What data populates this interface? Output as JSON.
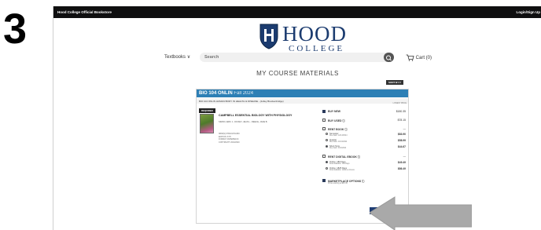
{
  "step_number": "3",
  "topbar": {
    "store_name": "Hood College Official Bookstore",
    "login": "Login/Sign Up"
  },
  "logo": {
    "word": "HOOD",
    "sub": "COLLEGE"
  },
  "nav": {
    "category": "Textbooks",
    "search_placeholder": "Search",
    "cart_label": "Cart (0)"
  },
  "page_title": "MY COURSE MATERIALS",
  "sort_label": "SORT BY",
  "course": {
    "header": "BIO 104 ONLIN",
    "term": "Fall 2024",
    "subtitle": "BIO 104 ONLIN HUMAN BODY IN HEALTH & DISEASE - (Jolley Breckenbridge)",
    "required_badge": "REQUIRED",
    "book": {
      "title": "CAMPBELL ESSENTIAL BIOLOGY WITH PHYSIOLOGY",
      "authors": "SIMON, ERIC J.; DICKEY, JEAN L.; REECE, JANE B.",
      "isbn": "ISBN(S) 9780134711683",
      "edition": "EDITION: 6TH",
      "format": "FORMAT: PAPERBACK",
      "copyright": "COPYRIGHT: 2019/2020"
    },
    "lowest_price_label": "LOWEST PRICE",
    "options": {
      "buy_new": {
        "label": "BUY NEW",
        "price": "$180.35"
      },
      "buy_used": {
        "label": "BUY USED",
        "price": "$78.15"
      },
      "rent_book": {
        "label": "RENT BOOK",
        "price": "—"
      },
      "rent_semester": {
        "label": "Semester",
        "due": "Due back: 12/13/2024",
        "price": "$83.90"
      },
      "rent_quarter": {
        "label": "Quarter",
        "due": "Due back: 11/13/2024",
        "price": "$58.99"
      },
      "rent_short": {
        "label": "Short Term",
        "due": "Due back: 9/13/2024",
        "price": "$44.67"
      },
      "rent_digital": {
        "label": "RENT DIGITAL EBOOK",
        "price": "—"
      },
      "digital_180": {
        "label": "Online: 180 Days",
        "due": "Downloadable: 180 Days",
        "price": "$49.49"
      },
      "digital_365": {
        "label": "Online: 1825 Days",
        "due": "Downloadable: Lifetime Access",
        "price": "$86.49"
      },
      "marketplace": {
        "label": "MARKETPLACE OPTIONS",
        "note": "Prices starting at $45.45"
      }
    },
    "add_button": "ADD ITEMS TO CART"
  },
  "colors": {
    "topbar": "#0f0f10",
    "course_header": "#2d7fb5",
    "button": "#1f3d73",
    "logo": "#1b3b6f"
  }
}
